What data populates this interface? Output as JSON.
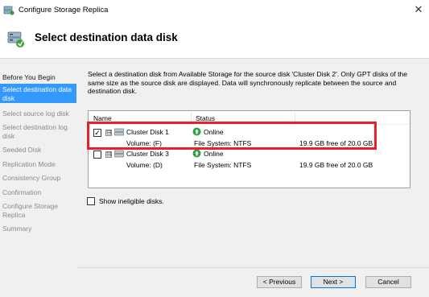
{
  "window": {
    "title": "Configure Storage Replica",
    "close_symbol": "✕"
  },
  "header": {
    "title": "Select destination data disk"
  },
  "sidebar": {
    "items": [
      {
        "label": "Before You Begin",
        "state": "visited"
      },
      {
        "label": "Select destination data disk",
        "state": "active"
      },
      {
        "label": "Select source log disk",
        "state": "upcoming"
      },
      {
        "label": "Select destination log disk",
        "state": "upcoming"
      },
      {
        "label": "Seeded Disk",
        "state": "upcoming"
      },
      {
        "label": "Replication Mode",
        "state": "upcoming"
      },
      {
        "label": "Consistency Group",
        "state": "upcoming"
      },
      {
        "label": "Confirmation",
        "state": "upcoming"
      },
      {
        "label": "Configure Storage Replica",
        "state": "upcoming"
      },
      {
        "label": "Summary",
        "state": "upcoming"
      }
    ]
  },
  "main": {
    "description": "Select a destination disk from Available Storage for the source disk 'Cluster Disk 2'. Only GPT disks of the same size as the source disk are displayed. Data will synchronously replicate between the source and destination disk.",
    "columns": [
      "Name",
      "Status"
    ],
    "disks": [
      {
        "name": "Cluster Disk 1",
        "volume": "Volume: (F)",
        "status": "Online",
        "file_system": "File System: NTFS",
        "free_space": "19.9 GB free of 20.0 GB",
        "checked": true,
        "expander": "⊟"
      },
      {
        "name": "Cluster Disk 3",
        "volume": "Volume: (D)",
        "status": "Online",
        "file_system": "File System: NTFS",
        "free_space": "19.9 GB free of 20.0 GB",
        "checked": false,
        "expander": "⊟"
      }
    ],
    "show_ineligible_label": "Show ineligible disks.",
    "show_ineligible_checked": false
  },
  "buttons": {
    "previous": "< Previous",
    "next": "Next >",
    "cancel": "Cancel"
  },
  "colors": {
    "accent": "#3399ff",
    "highlight": "#e8202a",
    "online_green": "#2ea043"
  },
  "icons": {
    "app": "storage-replica-icon",
    "header": "storage-replica-wizard-icon",
    "disk": "disk-icon",
    "online": "online-status-icon"
  }
}
